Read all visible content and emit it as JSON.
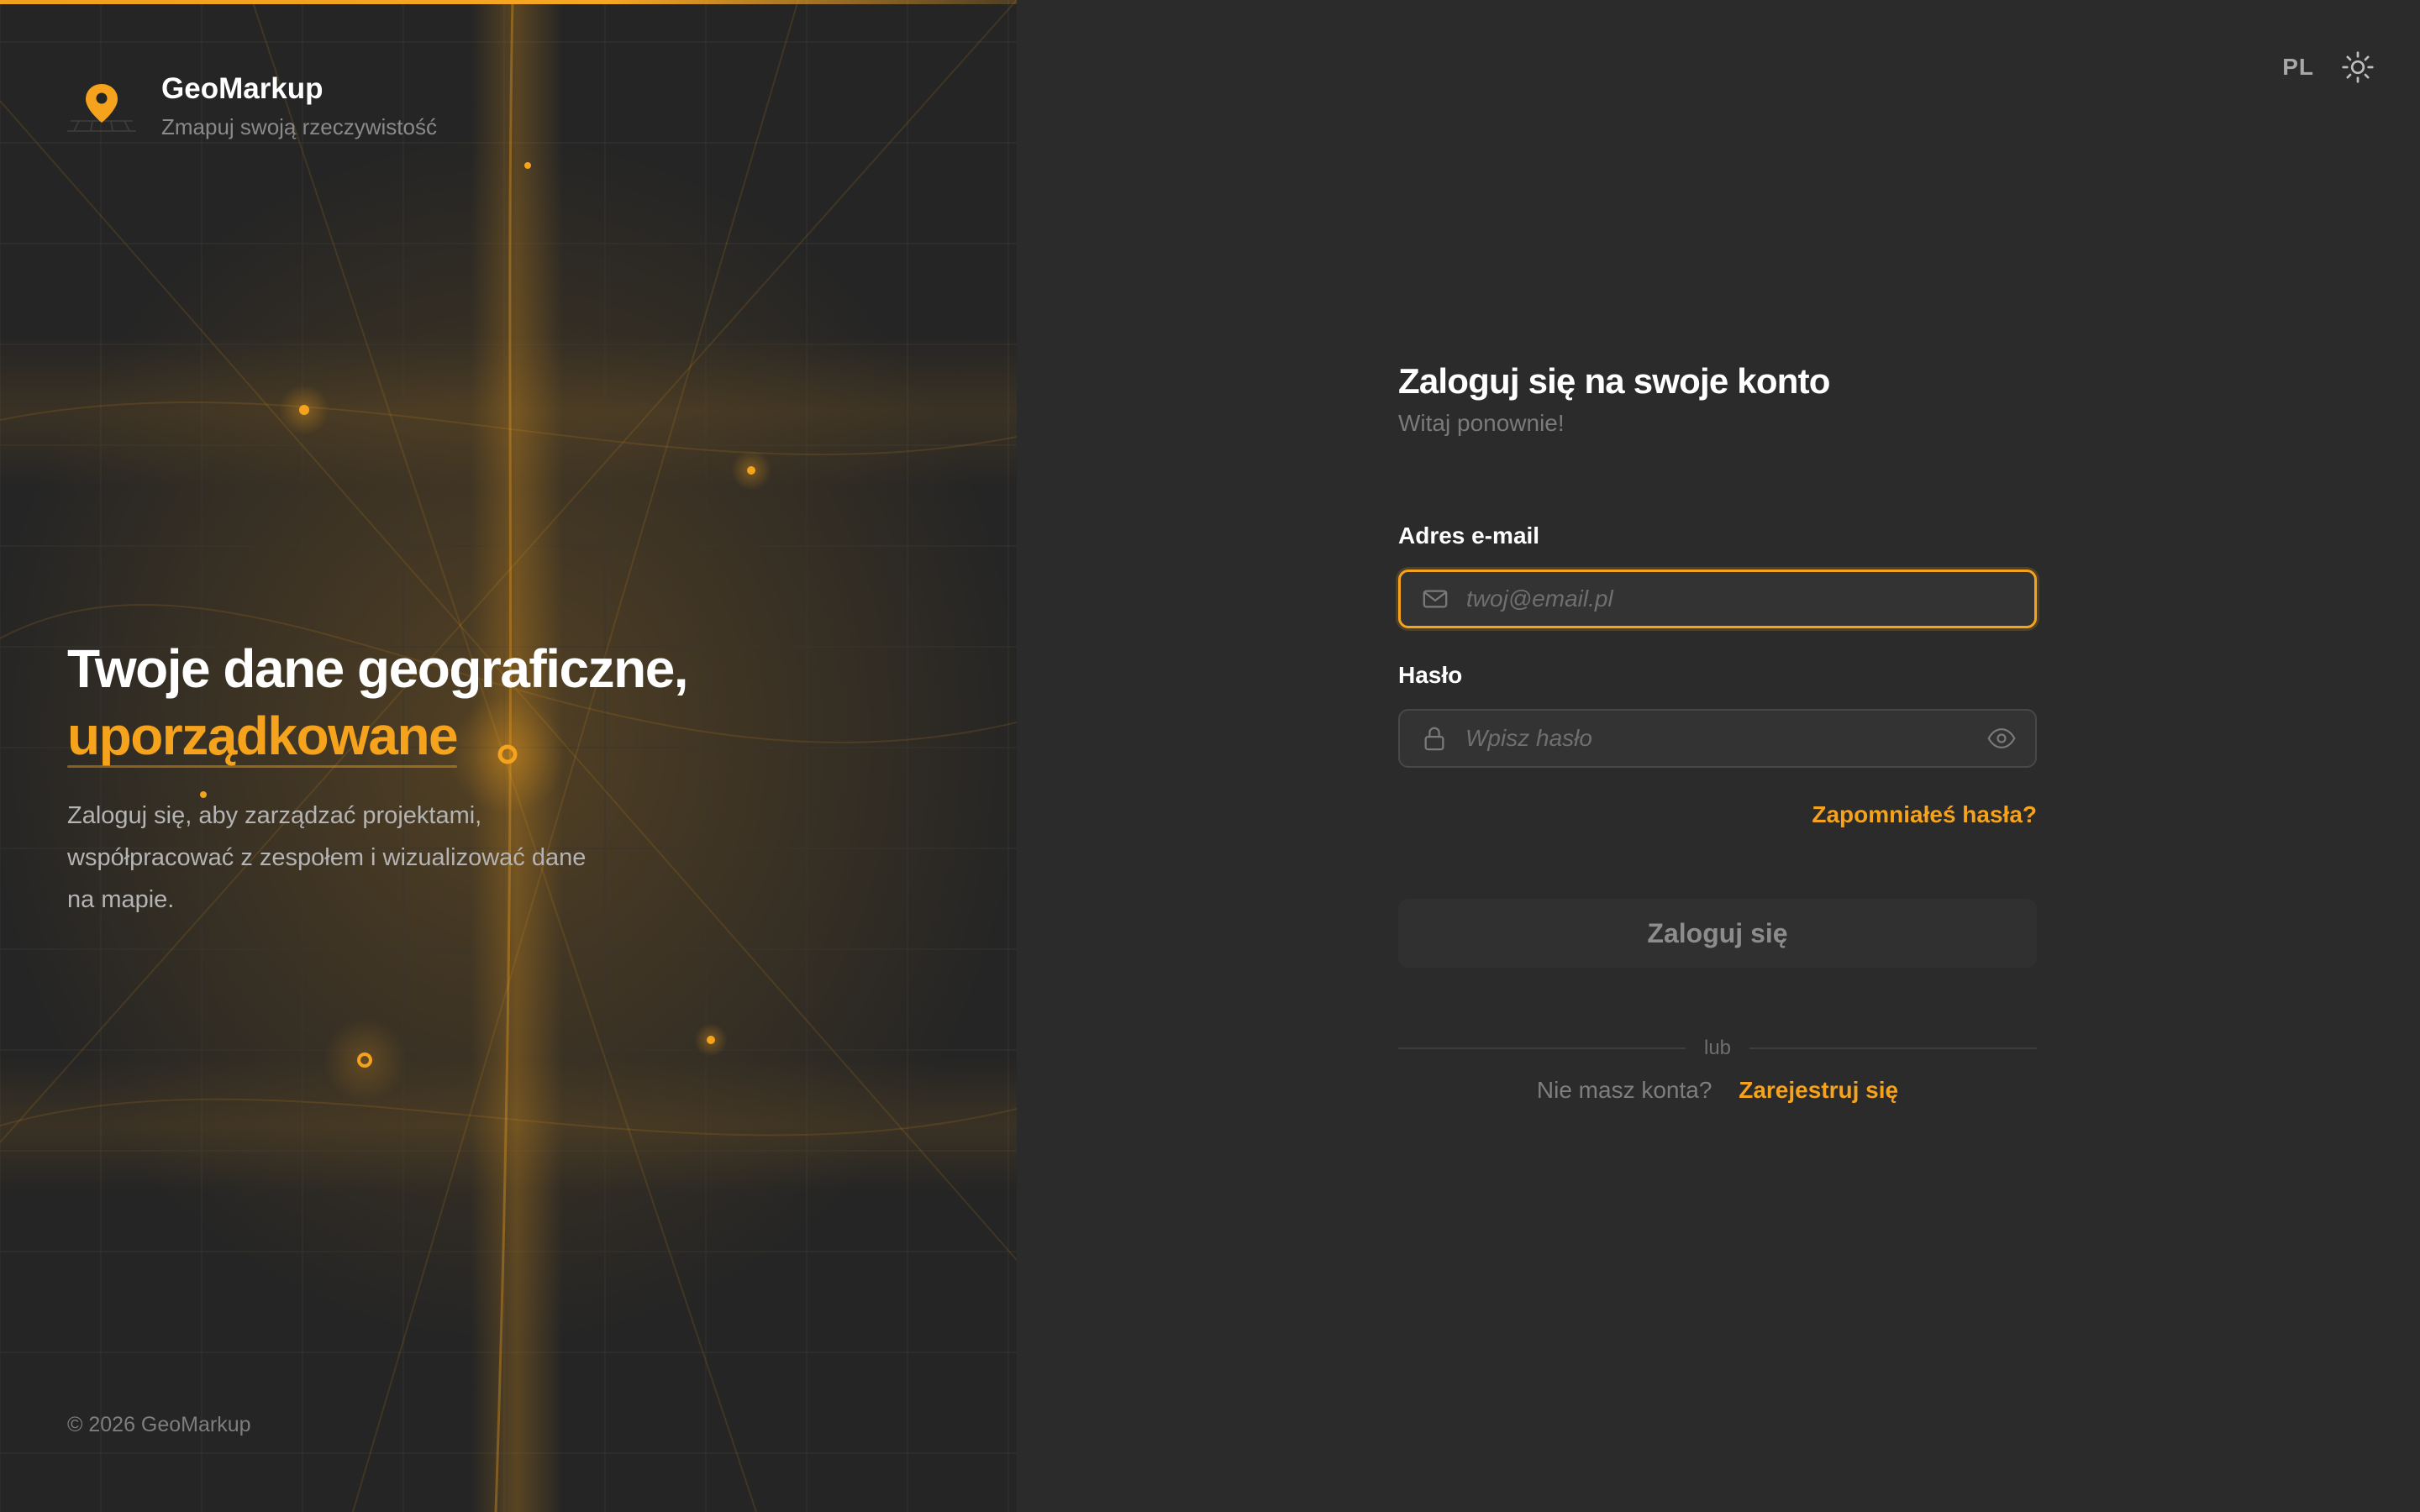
{
  "colors": {
    "accent": "#f5a21c",
    "left_bg": "#252525",
    "right_bg": "#2b2b2b",
    "input_bg": "#333333"
  },
  "brand": {
    "name": "GeoMarkup",
    "tagline": "Zmapuj swoją rzeczywistość",
    "logo_icon": "map-pin-icon"
  },
  "hero": {
    "title_line1": "Twoje dane geograficzne,",
    "title_highlight": "uporządkowane",
    "description": "Zaloguj się, aby zarządzać projektami, współpracować z zespołem i wizualizować dane na mapie."
  },
  "footer": {
    "copyright": "© 2026 GeoMarkup"
  },
  "topbar": {
    "language": "PL",
    "theme_icon": "sun-icon"
  },
  "login_form": {
    "title": "Zaloguj się na swoje konto",
    "subtitle": "Witaj ponownie!",
    "email": {
      "label": "Adres e-mail",
      "placeholder": "twoj@email.pl",
      "value": "",
      "icon": "mail-icon"
    },
    "password": {
      "label": "Hasło",
      "placeholder": "Wpisz hasło",
      "value": "",
      "icon": "lock-icon",
      "toggle_icon": "eye-icon"
    },
    "forgot_password": "Zapomniałeś hasła?",
    "submit_label": "Zaloguj się",
    "divider_text": "lub",
    "signup_prompt": "Nie masz konta?",
    "signup_link": "Zarejestruj się"
  }
}
